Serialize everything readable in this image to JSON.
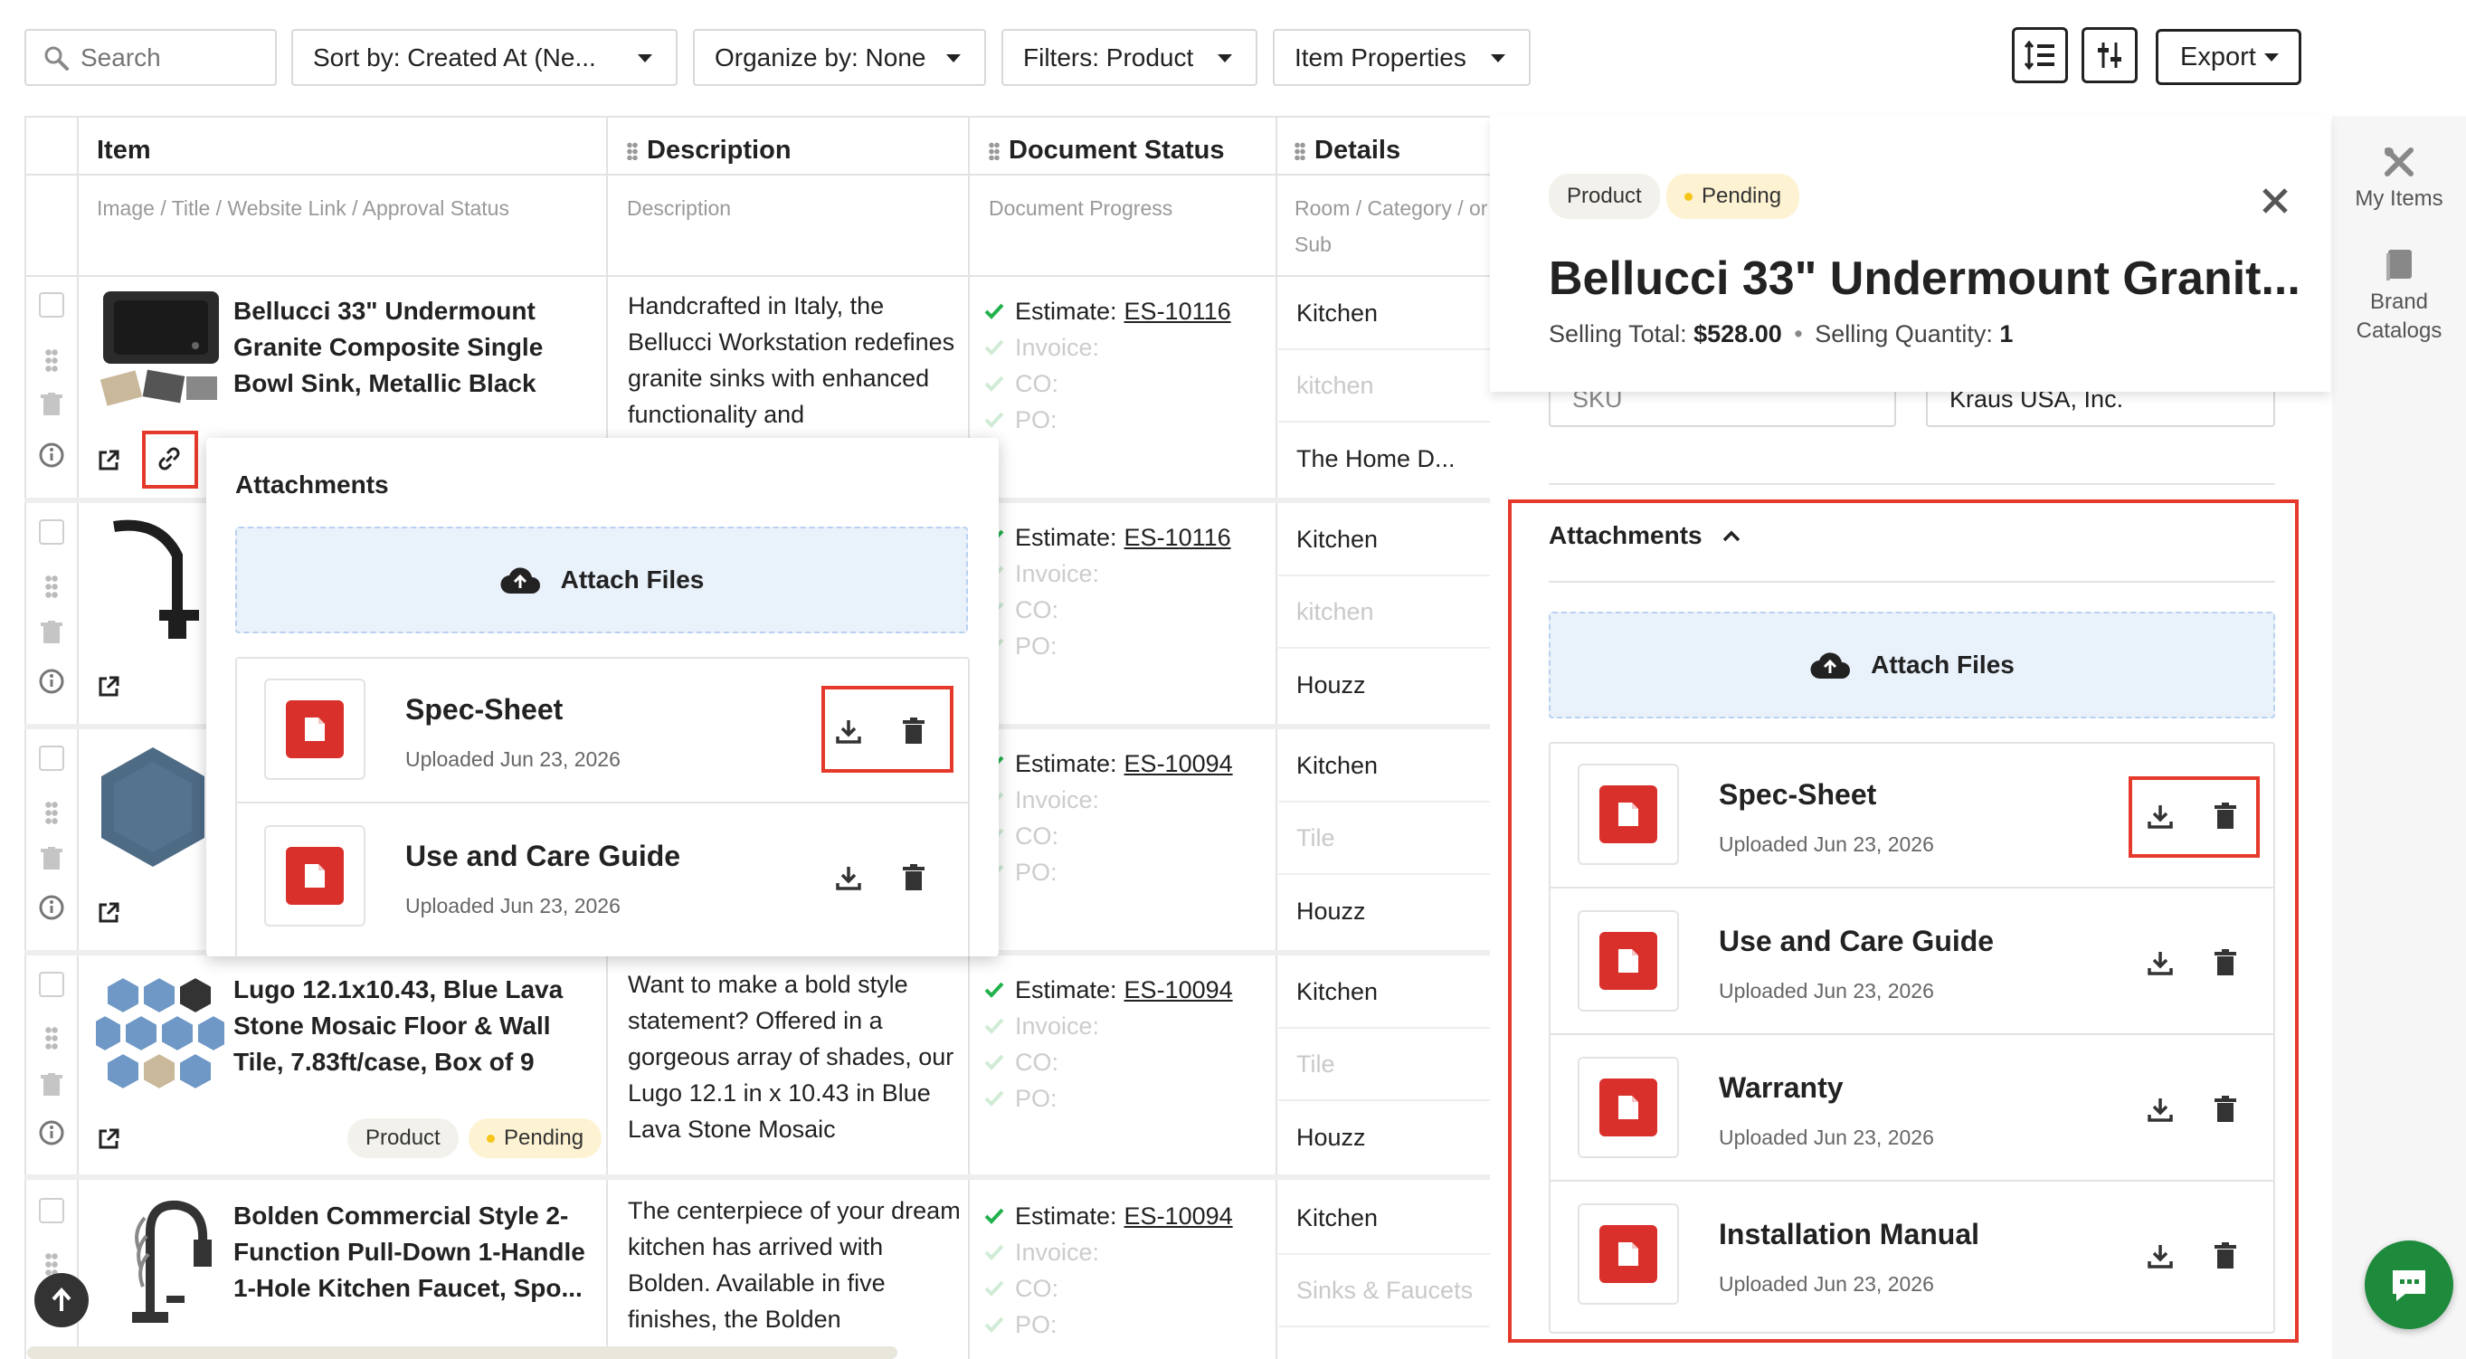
{
  "toolbar": {
    "search_placeholder": "Search",
    "sort_label": "Sort by: Created At (Ne...",
    "organize_label": "Organize by: None",
    "filters_label": "Filters: Product",
    "item_properties_label": "Item Properties",
    "export_label": "Export"
  },
  "table": {
    "columns": [
      {
        "title": "Item",
        "sub": "Image / Title / Website Link / Approval Status"
      },
      {
        "title": "Description",
        "sub": "Description"
      },
      {
        "title": "Document Status",
        "sub": "Document Progress"
      },
      {
        "title": "Details",
        "sub": "Room / Category / or Sub"
      }
    ],
    "rows": [
      {
        "title": "Bellucci 33\" Undermount Granite Composite Single Bowl Sink, Metallic Black",
        "description": "Handcrafted in Italy, the Bellucci Workstation redefines granite sinks with enhanced functionality and",
        "estimate_label": "Estimate:",
        "estimate_no": "ES-10116",
        "invoice": "Invoice:",
        "co": "CO:",
        "po": "PO:",
        "room": "Kitchen",
        "category": "kitchen",
        "vendor": "The Home D..."
      },
      {
        "title": "",
        "description": "",
        "estimate_label": "Estimate:",
        "estimate_no": "ES-10116",
        "invoice": "Invoice:",
        "co": "CO:",
        "po": "PO:",
        "room": "Kitchen",
        "category": "kitchen",
        "vendor": "Houzz"
      },
      {
        "title": "",
        "description": "",
        "estimate_label": "Estimate:",
        "estimate_no": "ES-10094",
        "invoice": "Invoice:",
        "co": "CO:",
        "po": "PO:",
        "room": "Kitchen",
        "category": "Tile",
        "vendor": "Houzz"
      },
      {
        "title": "Lugo 12.1x10.43, Blue Lava Stone Mosaic Floor & Wall Tile, 7.83ft/case, Box of 9",
        "description": "Want to make a bold style statement? Offered in a gorgeous array of shades, our Lugo 12.1 in x 10.43 in Blue Lava Stone Mosaic",
        "estimate_label": "Estimate:",
        "estimate_no": "ES-10094",
        "invoice": "Invoice:",
        "co": "CO:",
        "po": "PO:",
        "room": "Kitchen",
        "category": "Tile",
        "vendor": "Houzz",
        "chip_type": "Product",
        "chip_status": "Pending"
      },
      {
        "title": "Bolden Commercial Style 2-Function Pull-Down 1-Handle 1-Hole Kitchen Faucet, Spo...",
        "description": "The centerpiece of your dream kitchen has arrived with Bolden. Available in five finishes, the Bolden",
        "estimate_label": "Estimate:",
        "estimate_no": "ES-10094",
        "invoice": "Invoice:",
        "co": "CO:",
        "po": "PO:",
        "room": "Kitchen",
        "category": "Sinks & Faucets",
        "vendor": ""
      }
    ]
  },
  "popover": {
    "title": "Attachments",
    "attach_label": "Attach Files",
    "files": [
      {
        "name": "Spec-Sheet",
        "date": "Uploaded Jun 23, 2026"
      },
      {
        "name": "Use and Care Guide",
        "date": "Uploaded Jun 23, 2026"
      }
    ]
  },
  "panel": {
    "chip_type": "Product",
    "chip_status": "Pending",
    "title": "Bellucci 33\" Undermount Granit...",
    "selling_total_label": "Selling Total:",
    "selling_total": "$528.00",
    "selling_qty_label": "Selling Quantity:",
    "selling_qty": "1",
    "sku_label": "SKU",
    "brand_value": "Kraus USA, Inc.",
    "attachments_title": "Attachments",
    "attach_label": "Attach Files",
    "files": [
      {
        "name": "Spec-Sheet",
        "date": "Uploaded Jun 23, 2026"
      },
      {
        "name": "Use and Care Guide",
        "date": "Uploaded Jun 23, 2026"
      },
      {
        "name": "Warranty",
        "date": "Uploaded Jun 23, 2026"
      },
      {
        "name": "Installation Manual",
        "date": "Uploaded Jun 23, 2026"
      }
    ]
  },
  "rail": {
    "my_items": "My Items",
    "brand_catalogs": "Brand Catalogs"
  },
  "colors": {
    "highlight": "#e53a2b",
    "pdf": "#d9302b",
    "check": "#22b14c",
    "chat": "#1e8a3c"
  }
}
